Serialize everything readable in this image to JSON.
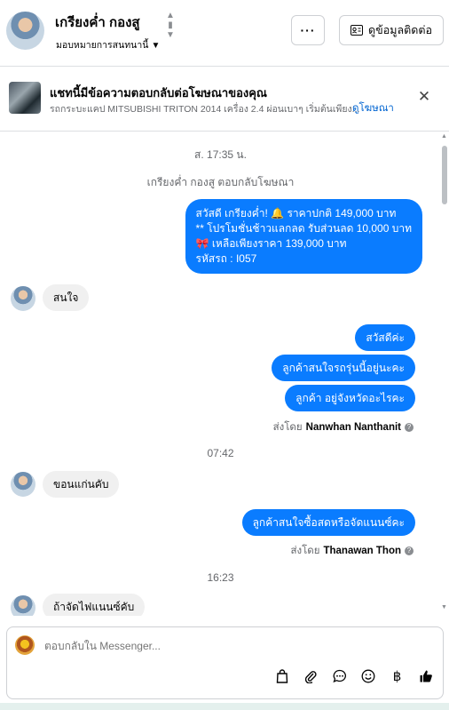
{
  "header": {
    "contact_name": "เกรียงค่ำ กองสู",
    "assign_label": "มอบหมายการสนทนานี้",
    "more_label": "···",
    "contact_info_label": "ดูข้อมูลติดต่อ"
  },
  "ad_banner": {
    "title": "แชทนี้มีข้อความตอบกลับต่อโฆษณาของคุณ",
    "subtitle": "รถกระบะแคป MITSUBISHI TRITON 2014 เครื่อง 2.4 ผ่อนเบาๆ เริ่มต้นเพียง...",
    "link": "ดูโฆษณา",
    "close": "✕"
  },
  "thread": {
    "timestamp_1": "ส. 17:35 น.",
    "ad_reply_note": "เกรียงค่ำ กองสู ตอบกลับโฆษณา",
    "ad_message_lines": [
      "สวัสดี เกรียงค่ำ! 🔔 ราคาปกติ 149,000 บาท",
      "** โปรโมชั่นช้าวแลกลด รับส่วนลด 10,000 บาท",
      "🎀 เหลือเพียงราคา 139,000 บาท",
      " รหัสรถ : I057"
    ],
    "in_1": "สนใจ",
    "out_1": "สวัสดีค่ะ",
    "out_2": "ลูกค้าสนใจรถรุ่นนี้อยู่นะคะ",
    "out_3": "ลูกค้า อยู่จังหวัดอะไรคะ",
    "sent_by_label": "ส่งโดย",
    "sent_by_1": "Nanwhan Nanthanit",
    "timestamp_2": "07:42",
    "in_2": "ขอนแก่นคับ",
    "out_4": "ลูกค้าสนใจซื้อสดหรือจัดแนนซ์คะ",
    "sent_by_2": "Thanawan Thon",
    "timestamp_3": "16:23",
    "in_3": "ถ้าจัดไฟแนนซ์คับ"
  },
  "composer": {
    "placeholder": "ตอบกลับใน Messenger...",
    "tools": [
      "bag-icon",
      "attachment-icon",
      "saved-replies-icon",
      "emoji-icon",
      "baht-icon",
      "like-icon"
    ]
  },
  "colors": {
    "outgoing_bubble": "#0a7cff",
    "incoming_bubble": "#f0f0f0",
    "link": "#0064d1"
  }
}
